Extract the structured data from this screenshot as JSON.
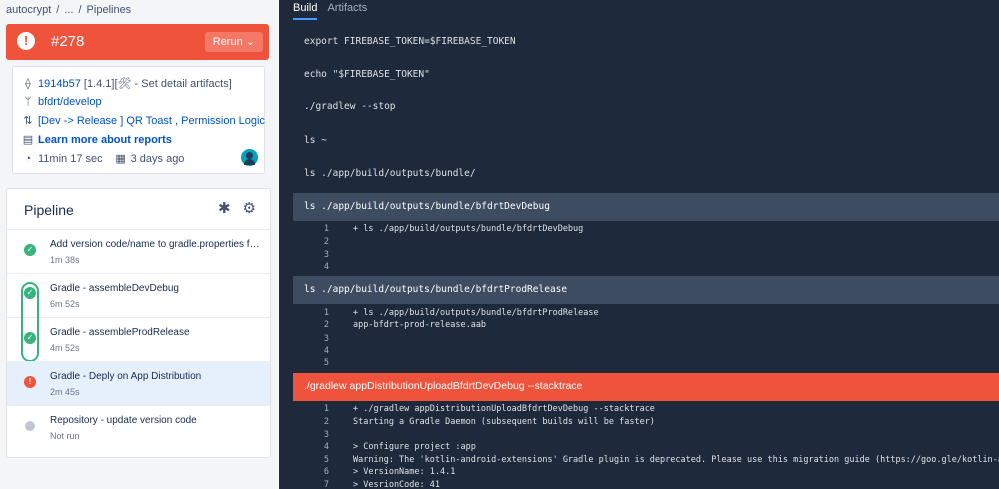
{
  "breadcrumb": {
    "repo": "autocrypt",
    "ellipsis": "...",
    "page": "Pipelines",
    "sep": "/"
  },
  "build": {
    "number": "#278",
    "status_icon": "!",
    "rerun_label": "Rerun",
    "status_color": "#f0533b"
  },
  "info": {
    "commit_hash": "1914b57",
    "commit_message": "[1.4.1][🛠 - Set detail artifacts]",
    "branch": "bfdrt/develop",
    "pr": "[Dev -> Release ] QR Toast , Permission Logic",
    "reports_link": "Learn more about reports",
    "duration": "11min 17 sec",
    "date": "3 days ago",
    "icons": [
      "commit-icon",
      "branch-icon",
      "pull-request-icon",
      "reports-icon",
      "clock-icon",
      "calendar-icon"
    ]
  },
  "pipeline": {
    "title": "Pipeline",
    "steps": [
      {
        "title": "Add version code/name to gradle.properties for ...",
        "time": "1m 38s",
        "status": "success"
      },
      {
        "title": "Gradle - assembleDevDebug",
        "time": "6m 52s",
        "status": "success"
      },
      {
        "title": "Gradle - assembleProdRelease",
        "time": "4m 52s",
        "status": "success"
      },
      {
        "title": "Gradle - Deply on App Distribution",
        "time": "2m 45s",
        "status": "failed"
      },
      {
        "title": "Repository - update version code",
        "time": "Not run",
        "status": "not-run"
      }
    ]
  },
  "tabs": {
    "build": "Build",
    "artifacts": "Artifacts"
  },
  "log": {
    "plain_commands": [
      "export FIREBASE_TOKEN=$FIREBASE_TOKEN",
      "echo \"$FIREBASE_TOKEN\"",
      "./gradlew --stop",
      "ls ~",
      "ls ./app/build/outputs/bundle/"
    ],
    "section1": {
      "command": "ls ./app/build/outputs/bundle/bfdrtDevDebug",
      "lines": [
        {
          "n": "1",
          "t": "+ ls ./app/build/outputs/bundle/bfdrtDevDebug"
        },
        {
          "n": "2",
          "t": ""
        },
        {
          "n": "3",
          "t": ""
        },
        {
          "n": "4",
          "t": ""
        }
      ]
    },
    "section2": {
      "command": "ls ./app/build/outputs/bundle/bfdrtProdRelease",
      "lines": [
        {
          "n": "1",
          "t": "+ ls ./app/build/outputs/bundle/bfdrtProdRelease"
        },
        {
          "n": "2",
          "t": "app-bfdrt-prod-release.aab"
        },
        {
          "n": "3",
          "t": ""
        },
        {
          "n": "4",
          "t": ""
        },
        {
          "n": "5",
          "t": ""
        }
      ]
    },
    "section3": {
      "command": "./gradlew appDistributionUploadBfdrtDevDebug --stacktrace",
      "lines": [
        {
          "n": "1",
          "t": "+ ./gradlew appDistributionUploadBfdrtDevDebug --stacktrace"
        },
        {
          "n": "2",
          "t": "Starting a Gradle Daemon (subsequent builds will be faster)"
        },
        {
          "n": "3",
          "t": ""
        },
        {
          "n": "4",
          "t": "> Configure project :app"
        },
        {
          "n": "5",
          "t": "Warning: The 'kotlin-android-extensions' Gradle plugin is deprecated. Please use this migration guide (https://goo.gle/kotlin-android-exten"
        },
        {
          "n": "6",
          "t": " > VersionName: 1.4.1"
        },
        {
          "n": "7",
          "t": " > VesrionCode: 41"
        }
      ]
    }
  }
}
